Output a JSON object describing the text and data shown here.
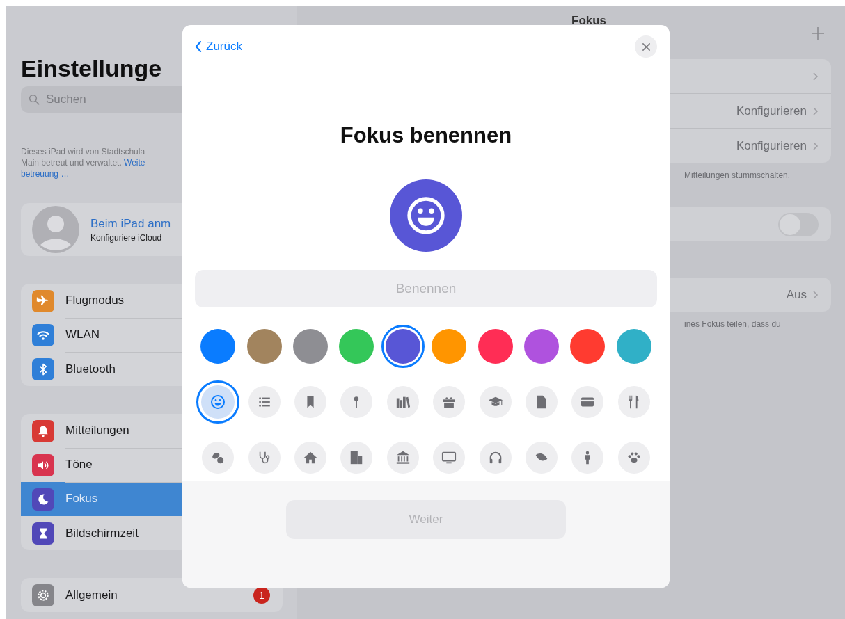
{
  "sidebar": {
    "title": "Einstellunge",
    "search": {
      "placeholder": "Suchen"
    },
    "note": {
      "lines": [
        "Dieses iPad wird von Stadtschula",
        "Main betreut und verwaltet."
      ],
      "link_parts": [
        "Weite",
        "betreuung …"
      ]
    },
    "account": {
      "title": "Beim iPad anm",
      "subtitle": "Konfiguriere iCloud"
    },
    "groups": [
      {
        "items": [
          {
            "label": "Flugmodus",
            "kind": "airplane",
            "color": "#e0892c",
            "selected": false
          },
          {
            "label": "WLAN",
            "kind": "wifi",
            "color": "#2f7fd8",
            "selected": false
          },
          {
            "label": "Bluetooth",
            "kind": "bluetooth",
            "color": "#2f7fd8",
            "selected": false
          }
        ]
      },
      {
        "items": [
          {
            "label": "Mitteilungen",
            "kind": "bell",
            "color": "#d83a35",
            "selected": false
          },
          {
            "label": "Töne",
            "kind": "speaker",
            "color": "#d8344f",
            "selected": false
          },
          {
            "label": "Fokus",
            "kind": "moon",
            "color": "#5148b8",
            "selected": true
          },
          {
            "label": "Bildschirmzeit",
            "kind": "hourglass",
            "color": "#5148b8",
            "selected": false
          }
        ]
      },
      {
        "items": [
          {
            "label": "Allgemein",
            "kind": "gear",
            "color": "#85858a",
            "selected": false,
            "badge": "1"
          }
        ]
      }
    ]
  },
  "detail": {
    "title": "Fokus",
    "groups": [
      {
        "rows": [
          {
            "kind": "link"
          },
          {
            "kind": "link",
            "value": "Konfigurieren"
          },
          {
            "kind": "link",
            "value": "Konfigurieren"
          }
        ],
        "footer": "Mitteilungen stummschalten."
      },
      {
        "rows": [
          {
            "kind": "toggle",
            "on": false
          }
        ]
      },
      {
        "rows": [
          {
            "kind": "link",
            "value": "Aus"
          }
        ],
        "footer": "ines Fokus teilen, dass du"
      }
    ]
  },
  "modal": {
    "back": "Zurück",
    "title": "Fokus benennen",
    "field": {
      "placeholder": "Benennen"
    },
    "colors": [
      {
        "color": "#0a7cff",
        "selected": false
      },
      {
        "color": "#a2845e",
        "selected": false
      },
      {
        "color": "#8e8e93",
        "selected": false
      },
      {
        "color": "#34c759",
        "selected": false
      },
      {
        "color": "#5856d6",
        "selected": true
      },
      {
        "color": "#ff9500",
        "selected": false
      },
      {
        "color": "#ff2d55",
        "selected": false
      },
      {
        "color": "#af52de",
        "selected": false
      },
      {
        "color": "#ff3b30",
        "selected": false
      },
      {
        "color": "#30b0c7",
        "selected": false
      }
    ],
    "symbol_rows": [
      [
        {
          "kind": "smiley",
          "selected": true
        },
        {
          "kind": "list",
          "selected": false
        },
        {
          "kind": "bookmark",
          "selected": false
        },
        {
          "kind": "pin",
          "selected": false
        },
        {
          "kind": "books",
          "selected": false
        },
        {
          "kind": "gift",
          "selected": false
        },
        {
          "kind": "cap",
          "selected": false
        },
        {
          "kind": "document",
          "selected": false
        },
        {
          "kind": "card",
          "selected": false
        },
        {
          "kind": "cutlery",
          "selected": false
        }
      ],
      [
        {
          "kind": "pills",
          "selected": false
        },
        {
          "kind": "stethoscope",
          "selected": false
        },
        {
          "kind": "house",
          "selected": false
        },
        {
          "kind": "buildings",
          "selected": false
        },
        {
          "kind": "bank",
          "selected": false
        },
        {
          "kind": "tv",
          "selected": false
        },
        {
          "kind": "headphones",
          "selected": false
        },
        {
          "kind": "leaf",
          "selected": false
        },
        {
          "kind": "person",
          "selected": false
        },
        {
          "kind": "paw",
          "selected": false
        }
      ]
    ],
    "button": {
      "label": "Weiter",
      "disabled": true
    }
  }
}
